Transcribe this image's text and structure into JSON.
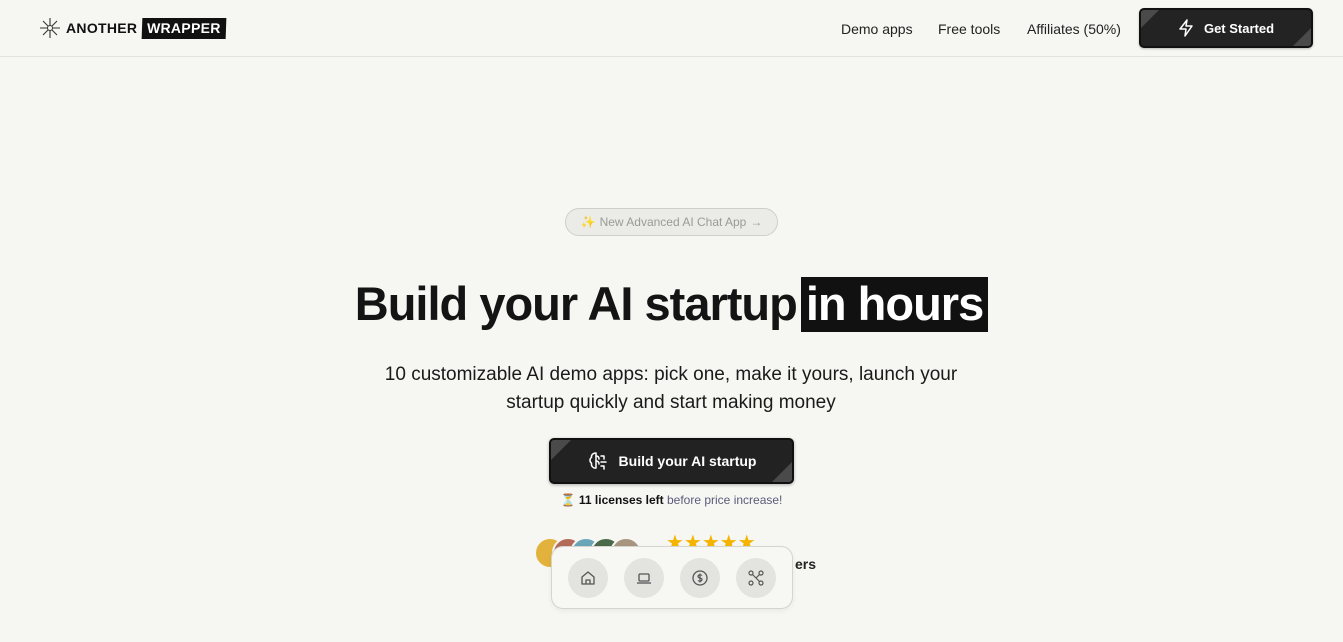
{
  "header": {
    "logo_word_1": "ANOTHER",
    "logo_word_2": "WRAPPER",
    "nav": [
      "Demo apps",
      "Free tools",
      "Affiliates (50%)"
    ],
    "cta_label": "Get Started"
  },
  "announcement": {
    "emoji": "✨",
    "text": "New Advanced AI Chat App",
    "arrow": "→"
  },
  "hero": {
    "title_main": "Build your AI startup",
    "title_highlight": "in hours",
    "subtitle": "10 customizable AI demo apps: pick one, make it yours, launch your startup quickly and start making money",
    "cta_label": "Build your AI startup",
    "licenses_icon": "⏳",
    "licenses_count": "11 licenses left",
    "licenses_suffix": "before price increase!"
  },
  "social_proof": {
    "stars": "★★★★★",
    "loved_by_partial": "ers",
    "rating": 5
  },
  "dock": {
    "items": [
      "home-icon",
      "laptop-icon",
      "dollar-icon",
      "network-icon"
    ]
  },
  "colors": {
    "background": "#f6f6f2",
    "dark": "#222222",
    "star": "#f5b400"
  }
}
